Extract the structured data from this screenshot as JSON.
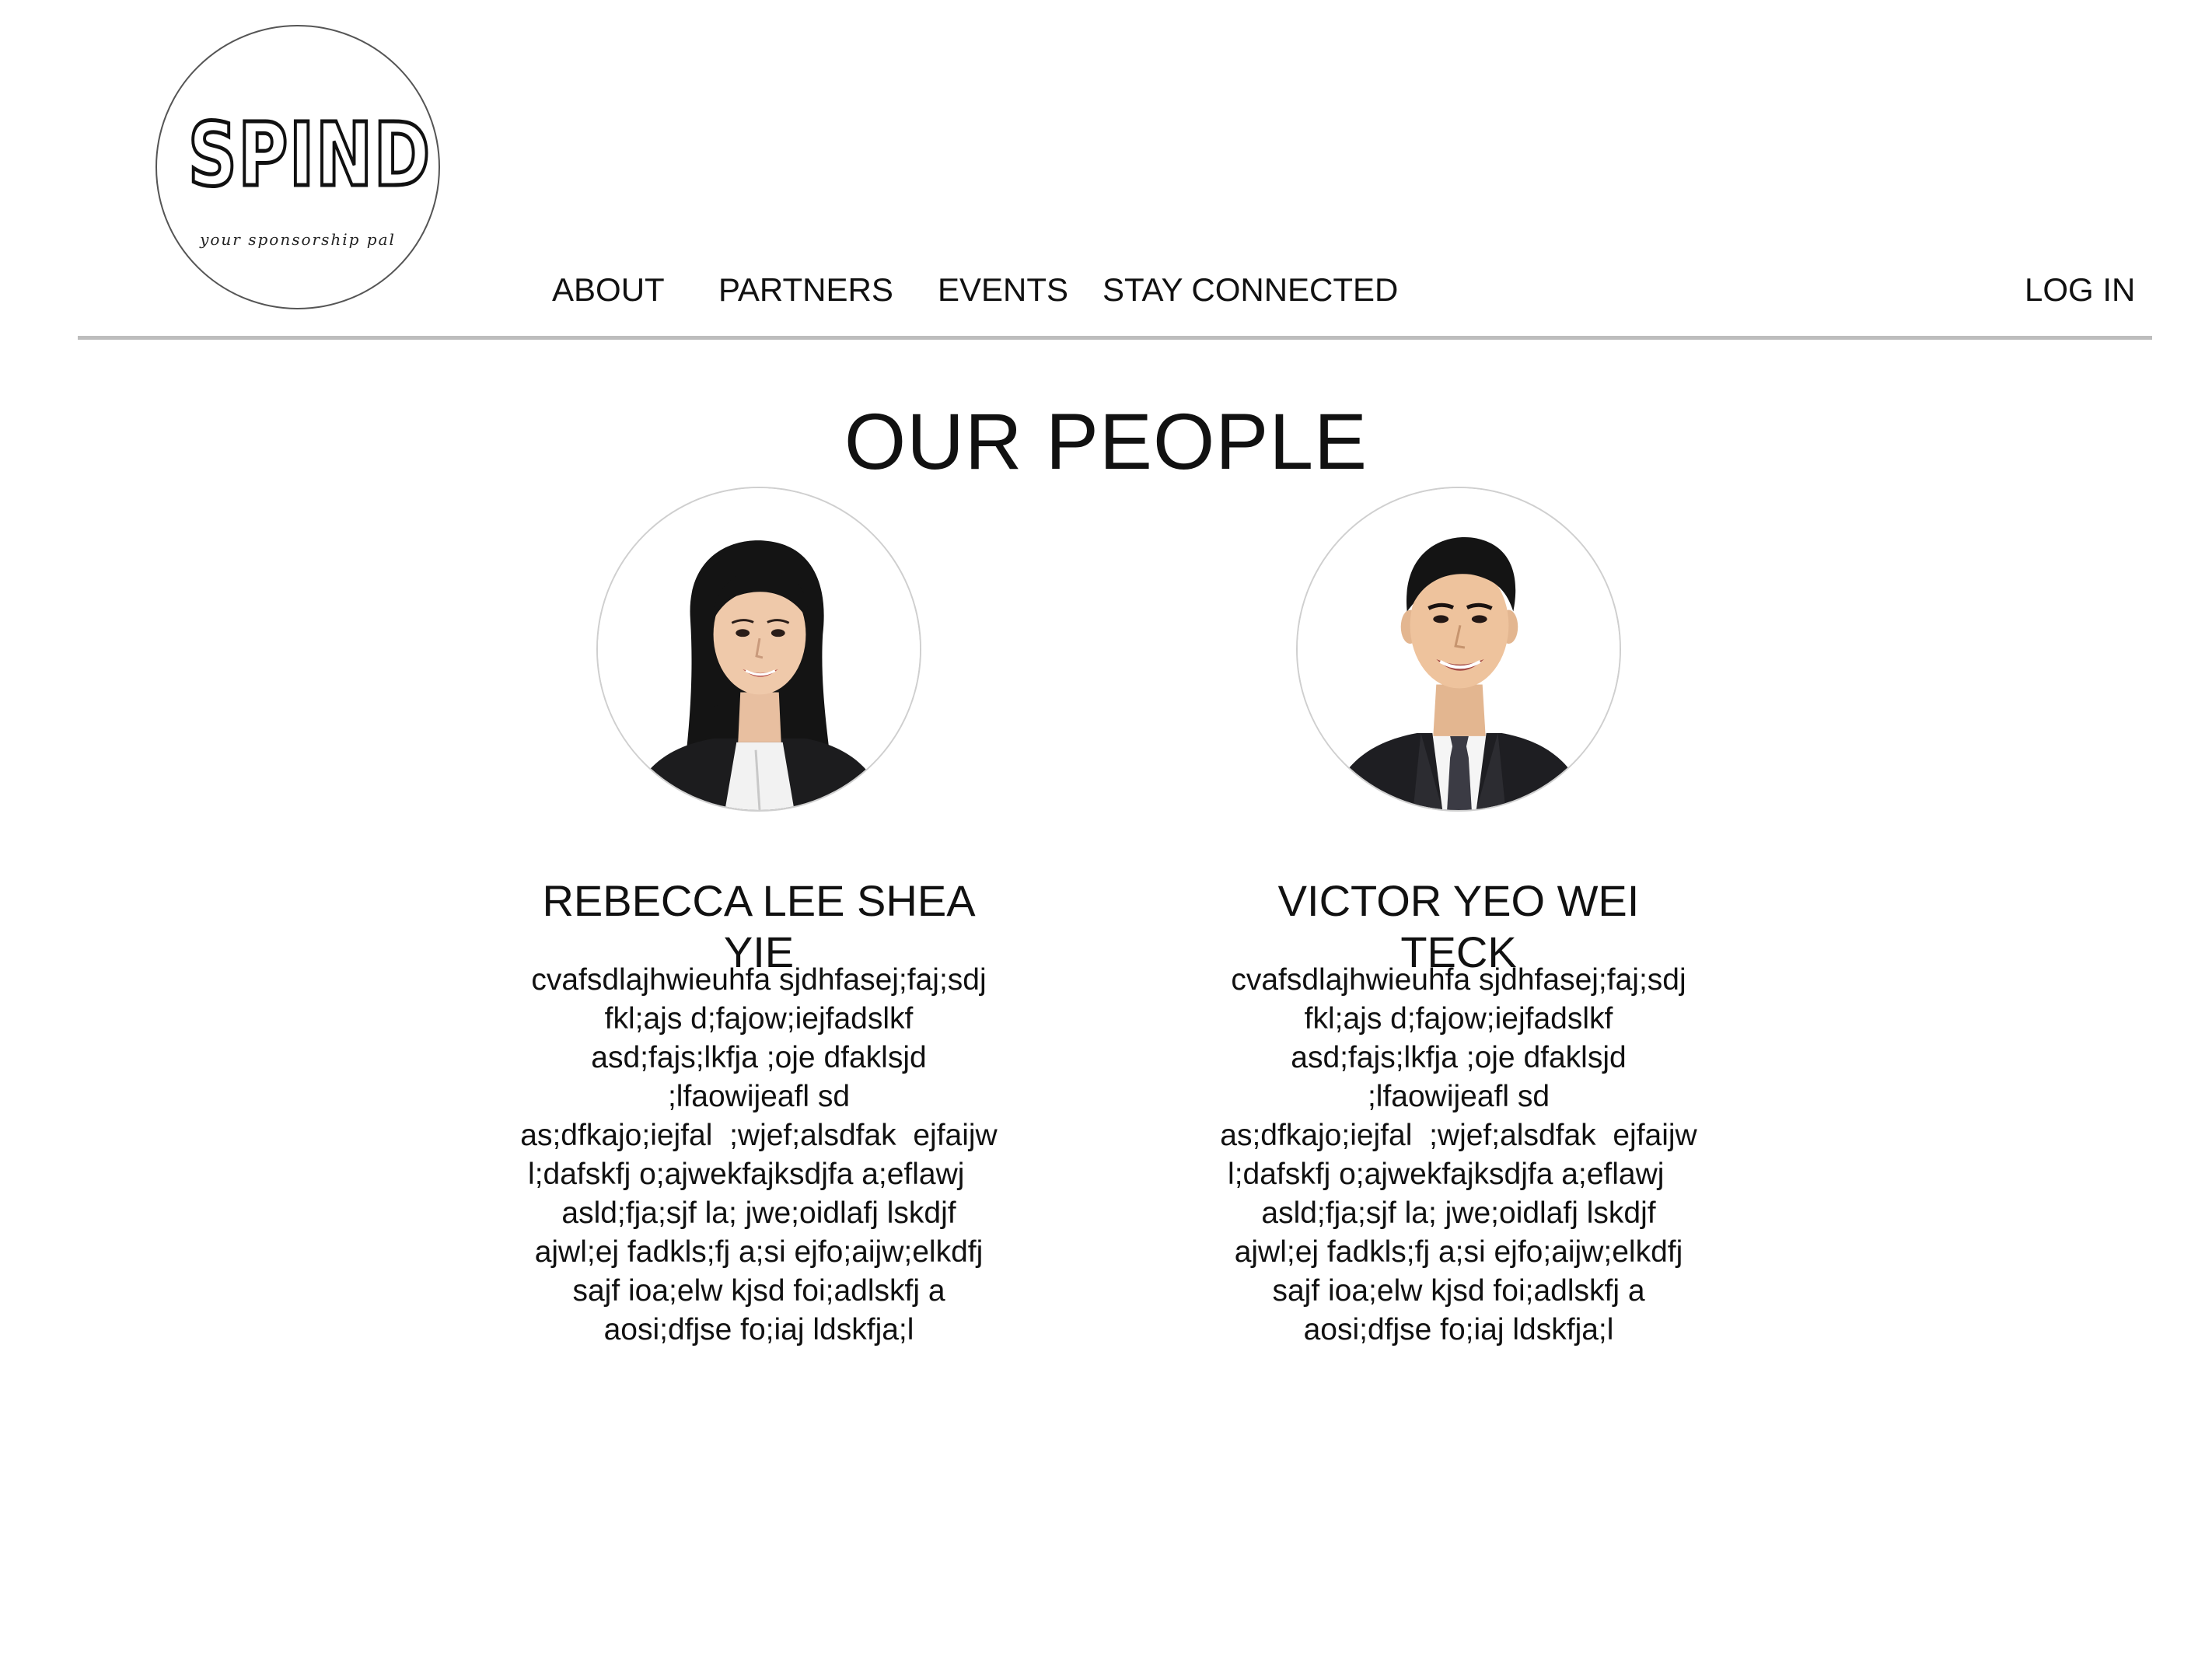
{
  "logo": {
    "word": "SPIND",
    "tagline": "your sponsorship pal"
  },
  "nav": {
    "about": "ABOUT",
    "partners": "PARTNERS",
    "events": "EVENTS",
    "stay_connected": "STAY CONNECTED",
    "login": "LOG IN"
  },
  "page": {
    "title": "OUR PEOPLE"
  },
  "people": [
    {
      "name": "REBECCA LEE SHEA YIE",
      "bio": [
        "cvafsdlajhwieuhfa sjdhfasej;faj;sdj",
        "fkl;ajs d;fajow;iejfadslkf",
        "asd;fajs;lkfja ;oje dfaklsjd",
        ";lfaowijeafl sd",
        "as;dfkajo;iejfal  ;wjef;alsdfak  ejfaijw",
        "l;dafskfj o;ajwekfajksdjfa a;eflawj   ",
        "asld;fja;sjf la; jwe;oidlafj lskdjf",
        "ajwl;ej fadkls;fj a;si ejfo;aijw;elkdfj",
        "sajf ioa;elw kjsd foi;adlskfj a",
        "aosi;dfjse fo;iaj ldskfja;l"
      ]
    },
    {
      "name": "VICTOR YEO WEI TECK",
      "bio": [
        "cvafsdlajhwieuhfa sjdhfasej;faj;sdj",
        "fkl;ajs d;fajow;iejfadslkf",
        "asd;fajs;lkfja ;oje dfaklsjd",
        ";lfaowijeafl sd",
        "as;dfkajo;iejfal  ;wjef;alsdfak  ejfaijw",
        "l;dafskfj o;ajwekfajksdjfa a;eflawj   ",
        "asld;fja;sjf la; jwe;oidlafj lskdjf",
        "ajwl;ej fadkls;fj a;si ejfo;aijw;elkdfj",
        "sajf ioa;elw kjsd foi;adlskfj a",
        "aosi;dfjse fo;iaj ldskfja;l"
      ]
    }
  ]
}
